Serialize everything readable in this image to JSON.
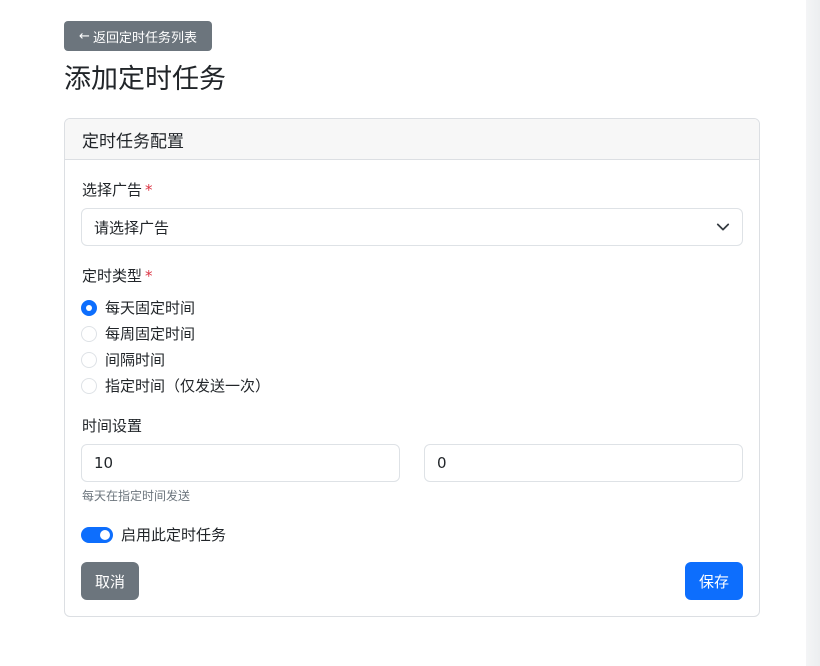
{
  "nav": {
    "back_arrow": "←",
    "back_label": "返回定时任务列表"
  },
  "page": {
    "title": "添加定时任务"
  },
  "card": {
    "header": "定时任务配置",
    "ad_select": {
      "label": "选择广告",
      "required_mark": "*",
      "selected_value": "请选择广告"
    },
    "schedule_type": {
      "label": "定时类型",
      "required_mark": "*",
      "options": [
        {
          "label": "每天固定时间",
          "checked": true
        },
        {
          "label": "每周固定时间",
          "checked": false
        },
        {
          "label": "间隔时间",
          "checked": false
        },
        {
          "label": "指定时间（仅发送一次）",
          "checked": false
        }
      ]
    },
    "time_settings": {
      "label": "时间设置",
      "hour_value": "10",
      "minute_value": "0",
      "help": "每天在指定时间发送"
    },
    "enable_switch": {
      "label": "启用此定时任务",
      "on": true
    },
    "actions": {
      "cancel_label": "取消",
      "save_label": "保存"
    }
  },
  "colors": {
    "primary": "#0d6efd",
    "secondary": "#6c757d",
    "required": "#dc3545"
  }
}
